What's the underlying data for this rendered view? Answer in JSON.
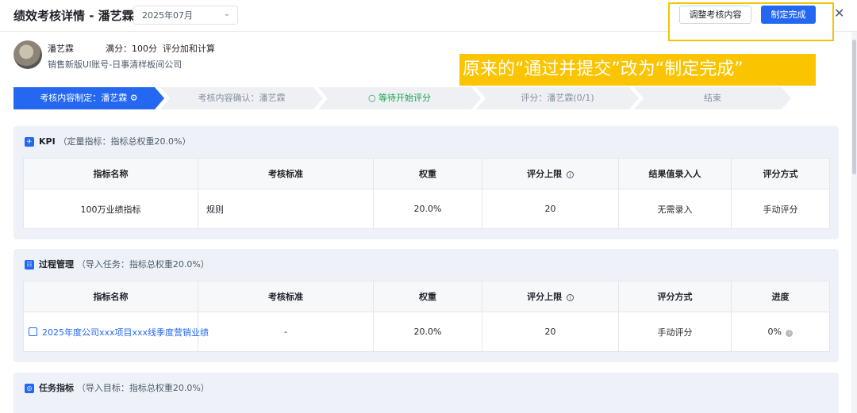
{
  "header": {
    "title": "绩效考核详情 - 潘艺霖",
    "month": "2025年07月",
    "adjust_label": "调整考核内容",
    "finish_label": "制定完成"
  },
  "profile": {
    "name": "潘艺霖",
    "full_score": "满分：100分",
    "rule": "评分加和计算",
    "dept": "销售新版UI账号-日事清样板间公司"
  },
  "annotation": "原来的“通过并提交”改为“制定完成”",
  "steps": [
    {
      "label": "考核内容制定：潘艺霖 ⚙",
      "state": "active"
    },
    {
      "label": "考核内容确认：潘艺霖",
      "state": "todo"
    },
    {
      "label": "○ 等待开始评分",
      "state": "waiting"
    },
    {
      "label": "评分：潘艺霖(0/1)",
      "state": "todo"
    },
    {
      "label": "结束",
      "state": "todo"
    }
  ],
  "kpi": {
    "title": "KPI",
    "subtitle": "（定量指标：指标总权重20.0%）",
    "headers": [
      "指标名称",
      "考核标准",
      "权重",
      "评分上限",
      "结果值录入人",
      "评分方式"
    ],
    "row": [
      "100万业绩指标",
      "规则",
      "20.0%",
      "20",
      "无需录入",
      "手动评分"
    ]
  },
  "process": {
    "title": "过程管理",
    "subtitle": "（导入任务：指标总权重20.0%）",
    "headers": [
      "指标名称",
      "考核标准",
      "权重",
      "评分上限",
      "评分方式",
      "进度"
    ],
    "row": [
      "2025年度公司xxx项目xxx线季度营销业绩",
      "-",
      "20.0%",
      "20",
      "手动评分",
      "0%"
    ]
  },
  "task": {
    "title": "任务指标",
    "subtitle": "（导入目标：指标总权重20.0%）"
  },
  "colors": {
    "primary": "#2468f2",
    "highlight": "#fbc400",
    "waiting": "#16a34a"
  }
}
